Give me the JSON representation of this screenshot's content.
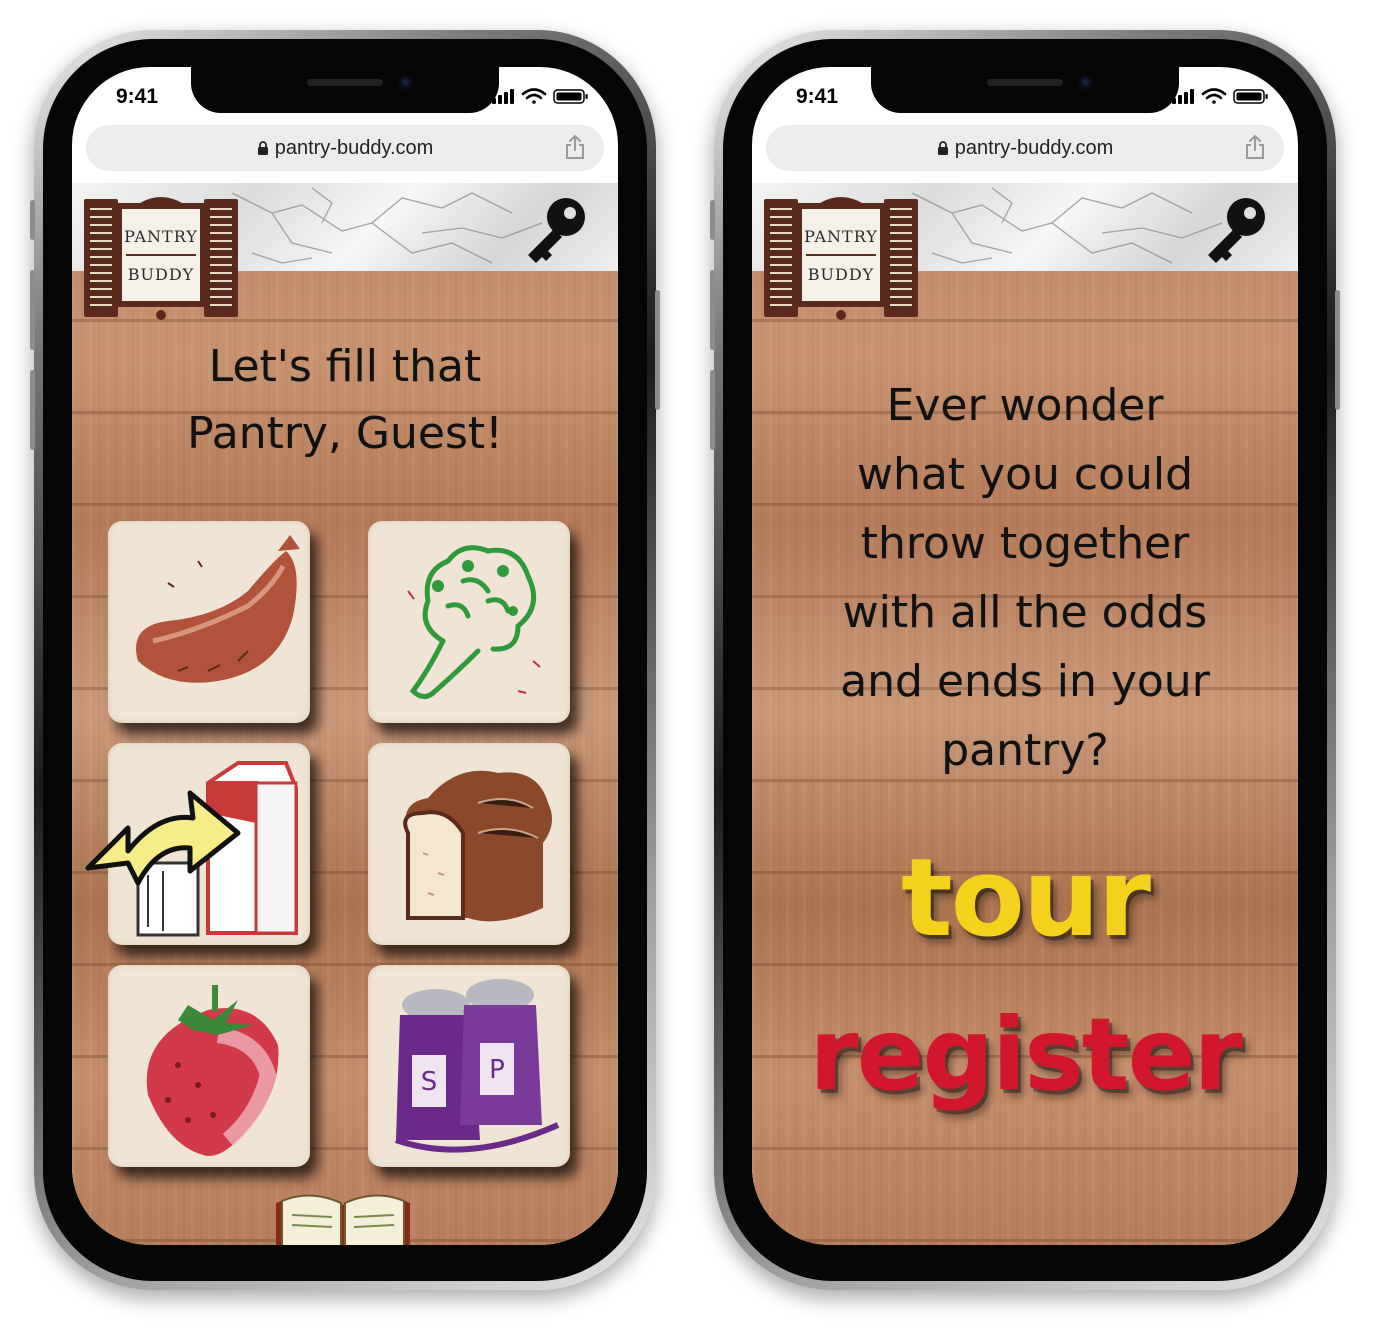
{
  "phones": [
    {
      "status_time": "9:41",
      "url": "pantry-buddy.com",
      "logo": {
        "line1": "PANTRY",
        "line2": "BUDDY"
      },
      "heading": [
        "Let's fill that",
        "Pantry, Guest!"
      ],
      "tiles": [
        {
          "icon": "sausage-icon"
        },
        {
          "icon": "broccoli-icon"
        },
        {
          "icon": "milk-carton-icon",
          "overlay": "swap-arrow-icon"
        },
        {
          "icon": "bread-loaf-icon"
        },
        {
          "icon": "strawberry-icon"
        },
        {
          "icon": "salt-pepper-icon",
          "letters": [
            "S",
            "P"
          ]
        }
      ],
      "footer_icon": "open-book-icon"
    },
    {
      "status_time": "9:41",
      "url": "pantry-buddy.com",
      "logo": {
        "line1": "PANTRY",
        "line2": "BUDDY"
      },
      "heading": [
        "Ever wonder",
        "what you could",
        "throw together",
        "with all the odds",
        "and ends in your",
        "pantry?"
      ],
      "tour_label": "tour",
      "register_label": "register"
    }
  ],
  "colors": {
    "magnet_yellow": "#f2d21a",
    "magnet_purple": "#6e3a9a",
    "magnet_green": "#1f9a49",
    "magnet_red": "#d2162b",
    "magnet_orange": "#d8731a",
    "tile_bg": "#f0e5d4",
    "logo_wood": "#5a2b1c"
  }
}
